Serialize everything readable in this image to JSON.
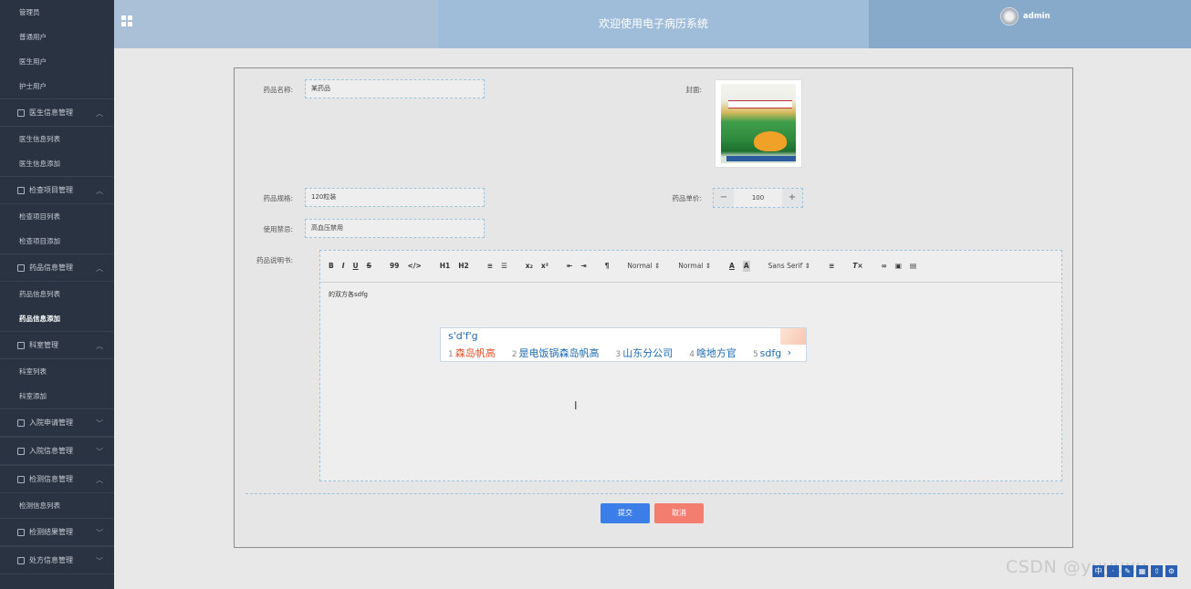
{
  "header": {
    "title": "欢迎使用电子病历系统",
    "username": "admin"
  },
  "sidebar": {
    "items": [
      {
        "type": "sub",
        "label": "管理员"
      },
      {
        "type": "sub",
        "label": "普通用户"
      },
      {
        "type": "sub",
        "label": "医生用户"
      },
      {
        "type": "sub",
        "label": "护士用户"
      },
      {
        "type": "group",
        "label": "医生信息管理",
        "expanded": true
      },
      {
        "type": "sub",
        "label": "医生信息列表"
      },
      {
        "type": "sub",
        "label": "医生信息添加"
      },
      {
        "type": "group",
        "label": "检查项目管理",
        "expanded": true
      },
      {
        "type": "sub",
        "label": "检查项目列表"
      },
      {
        "type": "sub",
        "label": "检查项目添加"
      },
      {
        "type": "group",
        "label": "药品信息管理",
        "expanded": true
      },
      {
        "type": "sub",
        "label": "药品信息列表"
      },
      {
        "type": "sub",
        "label": "药品信息添加",
        "active": true
      },
      {
        "type": "group",
        "label": "科室管理",
        "expanded": true
      },
      {
        "type": "sub",
        "label": "科室列表"
      },
      {
        "type": "sub",
        "label": "科室添加"
      },
      {
        "type": "group",
        "label": "入院申请管理",
        "expanded": false
      },
      {
        "type": "group",
        "label": "入院信息管理",
        "expanded": false
      },
      {
        "type": "group",
        "label": "检测信息管理",
        "expanded": true
      },
      {
        "type": "sub",
        "label": "检测信息列表"
      },
      {
        "type": "group",
        "label": "检测结果管理",
        "expanded": false
      },
      {
        "type": "group",
        "label": "处方信息管理",
        "expanded": false
      }
    ]
  },
  "form": {
    "name_label": "药品名称:",
    "name_value": "某药品",
    "cover_label": "封面:",
    "spec_label": "药品规格:",
    "spec_value": "120粒装",
    "price_label": "药品单价:",
    "price_value": "100",
    "taboo_label": "使用禁忌:",
    "taboo_value": "高血压禁用",
    "manual_label": "药品说明书:",
    "submit_label": "提交",
    "cancel_label": "取消"
  },
  "editor": {
    "content": "的双方各sdfg",
    "toolbar": {
      "bold": "B",
      "italic": "I",
      "underline": "U",
      "strike": "S",
      "quote": "99",
      "code": "</>",
      "h1": "H1",
      "h2": "H2",
      "sub": "x₂",
      "sup": "x²",
      "size_select": "Normal",
      "header_select": "Normal",
      "font_select": "Sans Serif"
    }
  },
  "ime": {
    "input": "s'd'f'g",
    "candidates": [
      {
        "num": "1",
        "text": "森岛帆高"
      },
      {
        "num": "2",
        "text": "是电饭锅森岛帆高"
      },
      {
        "num": "3",
        "text": "山东分公司"
      },
      {
        "num": "4",
        "text": "啥地方官"
      },
      {
        "num": "5",
        "text": "sdfg"
      }
    ],
    "next": "›"
  },
  "watermark": "CSDN @yuyuxu"
}
